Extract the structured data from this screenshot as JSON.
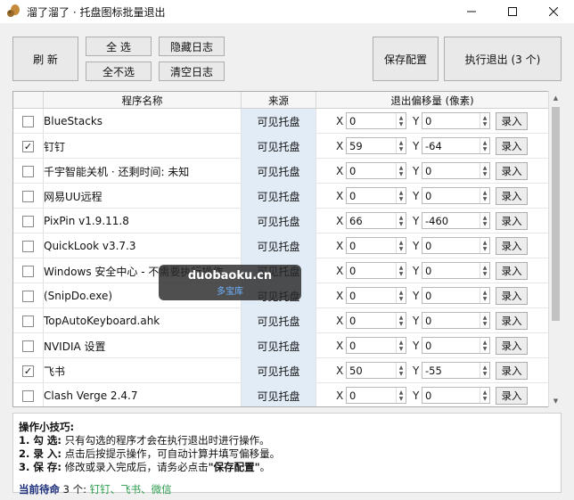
{
  "window": {
    "title": "溜了溜了 · 托盘图标批量退出",
    "controls": [
      "minimize",
      "maximize",
      "close"
    ],
    "icon": "squirrel-icon"
  },
  "toolbar": {
    "refresh": "刷 新",
    "select_all": "全 选",
    "select_none": "全不选",
    "hide_log": "隐藏日志",
    "clear_log": "清空日志",
    "save_config": "保存配置",
    "execute_exit": "执行退出 (3 个)"
  },
  "table": {
    "headers": {
      "name": "程序名称",
      "source": "来源",
      "offset": "退出偏移量 (像素)"
    },
    "record_label": "录入",
    "x_label": "X",
    "y_label": "Y",
    "rows": [
      {
        "checked": false,
        "check": "",
        "name": "BlueStacks",
        "source": "可见托盘",
        "x": "0",
        "y": "0"
      },
      {
        "checked": true,
        "check": "✓",
        "name": "钉钉",
        "source": "可见托盘",
        "x": "59",
        "y": "-64"
      },
      {
        "checked": false,
        "check": "",
        "name": "千宇智能关机 · 还剩时间: 未知",
        "source": "可见托盘",
        "x": "0",
        "y": "0"
      },
      {
        "checked": false,
        "check": "",
        "name": "网易UU远程",
        "source": "可见托盘",
        "x": "0",
        "y": "0"
      },
      {
        "checked": false,
        "check": "",
        "name": "PixPin v1.9.11.8",
        "source": "可见托盘",
        "x": "66",
        "y": "-460"
      },
      {
        "checked": false,
        "check": "",
        "name": "QuickLook v3.7.3",
        "source": "可见托盘",
        "x": "0",
        "y": "0"
      },
      {
        "checked": false,
        "check": "",
        "name": "Windows 安全中心 - 不需要执行操作。",
        "source": "可见托盘",
        "x": "0",
        "y": "0"
      },
      {
        "checked": false,
        "check": "",
        "name": "(SnipDo.exe)",
        "source": "可见托盘",
        "x": "0",
        "y": "0"
      },
      {
        "checked": false,
        "check": "",
        "name": "TopAutoKeyboard.ahk",
        "source": "可见托盘",
        "x": "0",
        "y": "0"
      },
      {
        "checked": false,
        "check": "",
        "name": "NVIDIA 设置",
        "source": "可见托盘",
        "x": "0",
        "y": "0"
      },
      {
        "checked": true,
        "check": "✓",
        "name": "飞书",
        "source": "可见托盘",
        "x": "50",
        "y": "-55"
      },
      {
        "checked": false,
        "check": "",
        "name": "Clash Verge 2.4.7",
        "source": "可见托盘",
        "x": "0",
        "y": "0"
      }
    ]
  },
  "watermark": {
    "main": "duobaoku.cn",
    "sub": "多宝库"
  },
  "tips": {
    "title": "操作小技巧:",
    "line1_label": "1. 勾 选:",
    "line1_text": "只有勾选的程序才会在执行退出时进行操作。",
    "line2_label": "2. 录 入:",
    "line2_text": "点击后按提示操作，可自动计算并填写偏移量。",
    "line3_label": "3. 保 存:",
    "line3_text_a": "修改或录入完成后，请务必点击",
    "line3_text_b": "\"保存配置\"",
    "line3_text_c": "。",
    "waiting_prefix": "当前待命",
    "waiting_count": "3 个:",
    "waiting_names": "钉钉、飞书、微信"
  },
  "colors": {
    "source_bg": "#e1ecf7",
    "waiting_names": "#2a9b4b",
    "waiting_prefix": "#1a2d7a"
  }
}
